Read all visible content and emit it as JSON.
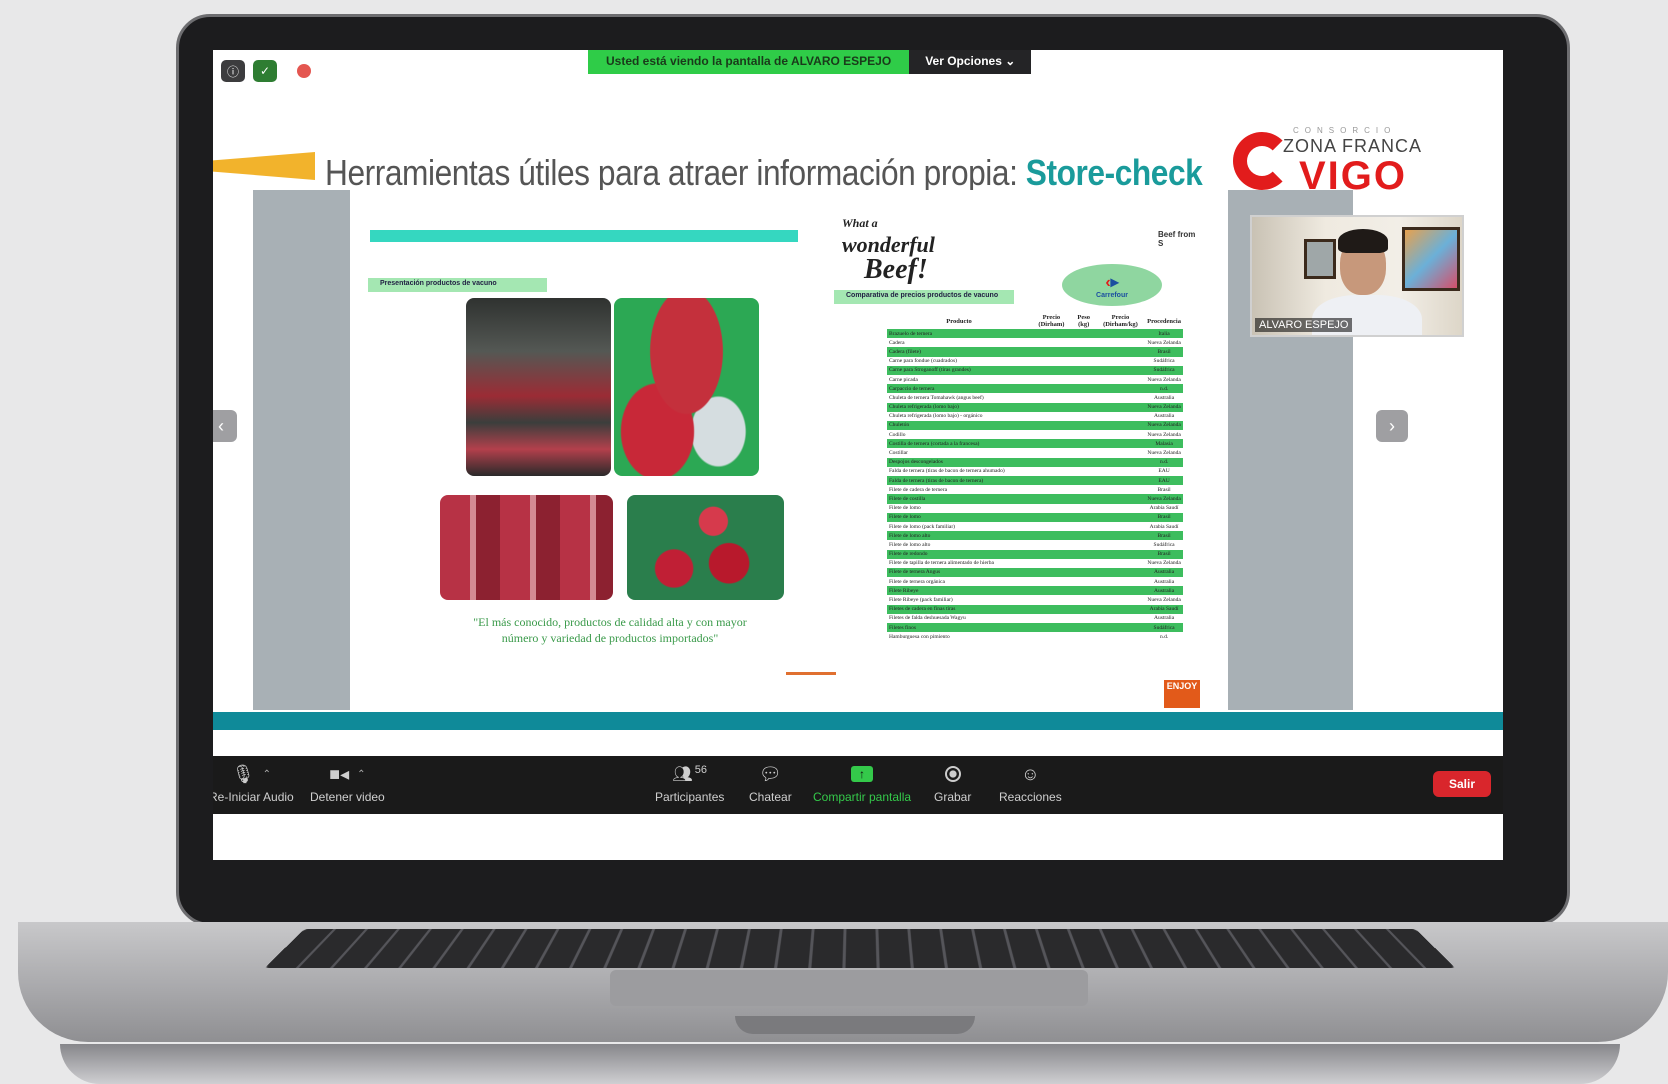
{
  "zoom": {
    "share_banner": "Usted está viendo la pantalla de ALVARO ESPEJO",
    "view_options": "Ver Opciones",
    "presenter_name": "ALVARO ESPEJO",
    "toolbar": {
      "audio": "Re-Iniciar Audio",
      "video": "Detener video",
      "participants": "Participantes",
      "participants_count": "56",
      "chat": "Chatear",
      "share": "Compartir pantalla",
      "record": "Grabar",
      "reactions": "Reacciones",
      "leave": "Salir"
    },
    "colors": {
      "share_green": "#2fcc48",
      "leave_red": "#d9262c",
      "toolbar_bg": "#1a1a1a"
    }
  },
  "slide": {
    "title_prefix": "Herramientas útiles para atraer información propia: ",
    "title_highlight": "Store-check",
    "logo": {
      "small": "CONSORCIO",
      "line1": "ZONA FRANCA",
      "line2": "VIGO"
    },
    "colors": {
      "title_highlight": "#1a9b9b",
      "logo_red": "#e21c1c",
      "footer_teal": "#0f8a99"
    }
  },
  "document": {
    "left_section_tag": "Presentación productos de vacuno",
    "right_section_tag": "Comparativa de precios productos de vacuno",
    "quote_line1": "\"El más conocido, productos de calidad alta y con mayor",
    "quote_line2": "número y variedad de productos importados\"",
    "beef_logo_lines": [
      "What a",
      "wonderful",
      "Beef!"
    ],
    "beef_from_logo": "Beef from S",
    "store_logo": "Carrefour",
    "enjoy_badge": "ENJOY",
    "table": {
      "headers": [
        "Producto",
        "Precio (Dirham)",
        "Peso (kg)",
        "Precio (Dirham/kg)",
        "Procedencia"
      ],
      "rows": [
        [
          "Brazuelo de ternera",
          "",
          "",
          "",
          "Italia"
        ],
        [
          "Cadera",
          "",
          "",
          "",
          "Nueva Zelanda"
        ],
        [
          "Cadera (filete)",
          "",
          "",
          "",
          "Brasil"
        ],
        [
          "Carne para fondue (cuadrados)",
          "",
          "",
          "",
          "Sudáfrica"
        ],
        [
          "Carne para Stroganoff (tiras grandes)",
          "",
          "",
          "",
          "Sudáfrica"
        ],
        [
          "Carne picada",
          "",
          "",
          "",
          "Nueva Zelanda"
        ],
        [
          "Carpaccio de ternera",
          "",
          "",
          "",
          "n.d."
        ],
        [
          "Chuleta de ternera Tomahawk (angus beef)",
          "",
          "",
          "",
          "Australia"
        ],
        [
          "Chuleta refrigerada (lomo bajo)",
          "",
          "",
          "",
          "Nueva Zelanda"
        ],
        [
          "Chuleta refrigerada (lomo bajo) - orgánico",
          "",
          "",
          "",
          "Australia"
        ],
        [
          "Chuletón",
          "",
          "",
          "",
          "Nueva Zelanda"
        ],
        [
          "Codillo",
          "",
          "",
          "",
          "Nueva Zelanda"
        ],
        [
          "Costilla de ternera (cortada a la francesa)",
          "",
          "",
          "",
          "Malasia"
        ],
        [
          "Costillar",
          "",
          "",
          "",
          "Nueva Zelanda"
        ],
        [
          "Despojos descongelados",
          "",
          "",
          "",
          "n.d."
        ],
        [
          "Falda de ternera (tiras de bacon de ternera ahumado)",
          "",
          "",
          "",
          "EAU"
        ],
        [
          "Falda de ternera (tiras de bacon de ternera)",
          "",
          "",
          "",
          "EAU"
        ],
        [
          "Filete de cadera de ternera",
          "",
          "",
          "",
          "Brasil"
        ],
        [
          "Filete de costilla",
          "",
          "",
          "",
          "Nueva Zelanda"
        ],
        [
          "Filete de lomo",
          "",
          "",
          "",
          "Arabia Saudí"
        ],
        [
          "Filete de lomo",
          "",
          "",
          "",
          "Brasil"
        ],
        [
          "Filete de lomo (pack familiar)",
          "",
          "",
          "",
          "Arabia Saudí"
        ],
        [
          "Filete de lomo alto",
          "",
          "",
          "",
          "Brasil"
        ],
        [
          "Filete de lomo alto",
          "",
          "",
          "",
          "Sudáfrica"
        ],
        [
          "Filete de redondo",
          "",
          "",
          "",
          "Brasil"
        ],
        [
          "Filete de tapilla de ternera alimentado de hierba",
          "",
          "",
          "",
          "Nueva Zelanda"
        ],
        [
          "Filete de ternera Angus",
          "",
          "",
          "",
          "Australia"
        ],
        [
          "Filete de ternera orgánica",
          "",
          "",
          "",
          "Australia"
        ],
        [
          "Filete Ribeye",
          "",
          "",
          "",
          "Australia"
        ],
        [
          "Filete Ribeye (pack familiar)",
          "",
          "",
          "",
          "Nueva Zelanda"
        ],
        [
          "Filetes de cadera en finas tiras",
          "",
          "",
          "",
          "Arabia Saudí"
        ],
        [
          "Filetes de falda deshuesada Wagyu",
          "",
          "",
          "",
          "Australia"
        ],
        [
          "Filetes finos",
          "",
          "",
          "",
          "Sudáfrica"
        ],
        [
          "Hamburguesa con pimiento",
          "",
          "",
          "",
          "n.d."
        ]
      ],
      "highlight_color": "#3dbd5e"
    }
  }
}
